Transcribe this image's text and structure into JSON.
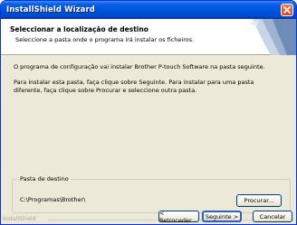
{
  "window": {
    "title": "InstallShield Wizard"
  },
  "header": {
    "title": "Seleccionar a localização de destino",
    "subtitle": "Seleccione a pasta onde o programa irá instalar os ficheiros."
  },
  "body": {
    "paragraph1": "O programa de configuração vai instalar Brother P-touch Software na pasta seguinte.",
    "paragraph2_line1": "Para instalar esta pasta, faça clique sobre Seguinte. Para instalar para uma pasta",
    "paragraph2_line2": "diferente, faça clique sobre Procurar e seleccione outra pasta."
  },
  "destination": {
    "group_label": "Pasta de destino",
    "path": "C:\\Programas\\Brother\\",
    "browse_label": "Procurar..."
  },
  "footer": {
    "brand": "InstallShield",
    "back_label": "< Retroceder",
    "next_label": "Seguinte >",
    "cancel_label": "Cancelar"
  }
}
